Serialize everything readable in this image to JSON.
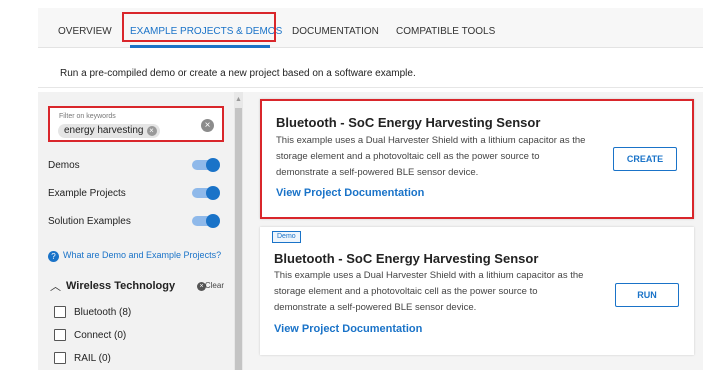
{
  "tabs": [
    {
      "label": "OVERVIEW"
    },
    {
      "label": "EXAMPLE PROJECTS & DEMOS"
    },
    {
      "label": "DOCUMENTATION"
    },
    {
      "label": "COMPATIBLE TOOLS"
    }
  ],
  "active_tab": "EXAMPLE PROJECTS & DEMOS",
  "intro_text": "Run a pre-compiled demo or create a new project based on a software example.",
  "sidebar": {
    "filter": {
      "label": "Filter on keywords",
      "chip": "energy harvesting"
    },
    "toggles": [
      {
        "label": "Demos",
        "on": true
      },
      {
        "label": "Example Projects",
        "on": true
      },
      {
        "label": "Solution Examples",
        "on": true
      }
    ],
    "help_link": "What are Demo and Example Projects?",
    "section": {
      "title": "Wireless Technology",
      "clear_label": "Clear",
      "items": [
        {
          "label": "Bluetooth (8)",
          "checked": false
        },
        {
          "label": "Connect (0)",
          "checked": false
        },
        {
          "label": "RAIL (0)",
          "checked": false
        }
      ]
    }
  },
  "cards": [
    {
      "badge": "",
      "title": "Bluetooth - SoC Energy Harvesting Sensor",
      "desc_lines": [
        "This example uses a Dual Harvester Shield with a lithium capacitor as the",
        "storage element and a photovoltaic cell as the power source to",
        "demonstrate a self-powered BLE sensor device."
      ],
      "link": "View Project Documentation",
      "button": "CREATE"
    },
    {
      "badge": "Demo",
      "title": "Bluetooth - SoC Energy Harvesting Sensor",
      "desc_lines": [
        "This example uses a Dual Harvester Shield with a lithium capacitor as the",
        "storage element and a photovoltaic cell as the power source to",
        "demonstrate a self-powered BLE sensor device."
      ],
      "link": "View Project Documentation",
      "button": "RUN"
    }
  ],
  "colors": {
    "accent": "#1a73c8",
    "highlight": "#d9262b"
  },
  "icons": [
    "clear-filter-icon",
    "chip-remove-icon",
    "info-icon",
    "chevron-up-icon",
    "clear-icon",
    "scroll-up-arrow-icon"
  ]
}
